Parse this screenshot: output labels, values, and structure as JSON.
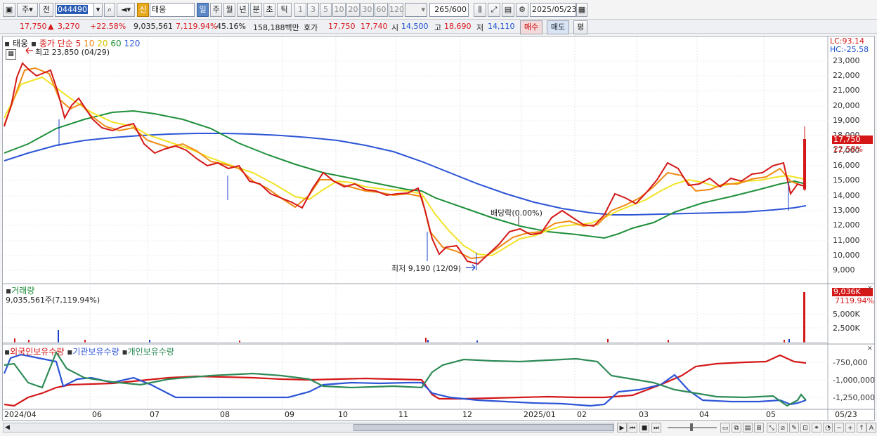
{
  "toolbar": {
    "period_type": "주",
    "jeon": "전",
    "code": "044490",
    "shin": "신",
    "name": "태웅",
    "periods": [
      "일",
      "주",
      "월",
      "년",
      "분",
      "초",
      "틱"
    ],
    "ticks": [
      "1",
      "3",
      "5",
      "10",
      "20",
      "30",
      "60",
      "120"
    ],
    "count": "265",
    "count_total": "/600",
    "date": "2025/05/23"
  },
  "info": {
    "price": "17,750",
    "change": "3,270",
    "change_pct": "+22.58%",
    "volume": "9,035,561",
    "volume_pct": "7,119.94%",
    "turnover": "45.16%",
    "amount": "158,188백만",
    "hoga_label": "호가",
    "ask": "17,750",
    "bid": "17,740",
    "open_label": "시",
    "open": "14,500",
    "high_label": "고",
    "high": "18,690",
    "low_label": "저",
    "low": "14,110",
    "buy": "매수",
    "sell": "매도",
    "eval": "평"
  },
  "price_panel": {
    "stock_label": "태웅",
    "ma_label": "종가 단순",
    "ma_periods": [
      "5",
      "10",
      "20",
      "60",
      "120"
    ],
    "high_note": "최고 23,850 (04/29)",
    "low_note": "최저 9,190 (12/09)",
    "dividend_note": "배당락(0.00%)",
    "lc": "LC:93.14",
    "hc": "HC:-25.58",
    "price_tag": "17,750",
    "pct_tag": "22.58%",
    "y_ticks": [
      "23,000",
      "22,000",
      "21,000",
      "20,000",
      "19,000",
      "18,000",
      "17,000",
      "16,000",
      "15,000",
      "14,000",
      "13,000",
      "12,000",
      "11,000",
      "10,000",
      "9,000"
    ]
  },
  "volume_panel": {
    "title": "거래량",
    "summary": "9,035,561주(7,119.94%)",
    "tag": "9,036K",
    "tag_pct": "7119.94%",
    "y_ticks": [
      "5,000K",
      "2,500K"
    ]
  },
  "holders_panel": {
    "series": [
      "외국인보유수량",
      "기관보유수량",
      "개인보유수량"
    ],
    "y_ticks": [
      "-750,000",
      "-1,000,000",
      "-1,250,000"
    ]
  },
  "x_axis": [
    "2024/04",
    "06",
    "07",
    "08",
    "09",
    "10",
    "11",
    "12",
    "2025/01",
    "02",
    "03",
    "04",
    "05",
    "05/23"
  ],
  "colors": {
    "ma5": "#d41818",
    "ma10": "#f08a14",
    "ma20": "#f2e324",
    "ma60": "#1e8f3a",
    "ma120": "#2d55d6",
    "foreign": "#d41818",
    "institution": "#2d55d6",
    "individual": "#2e8b57"
  }
}
